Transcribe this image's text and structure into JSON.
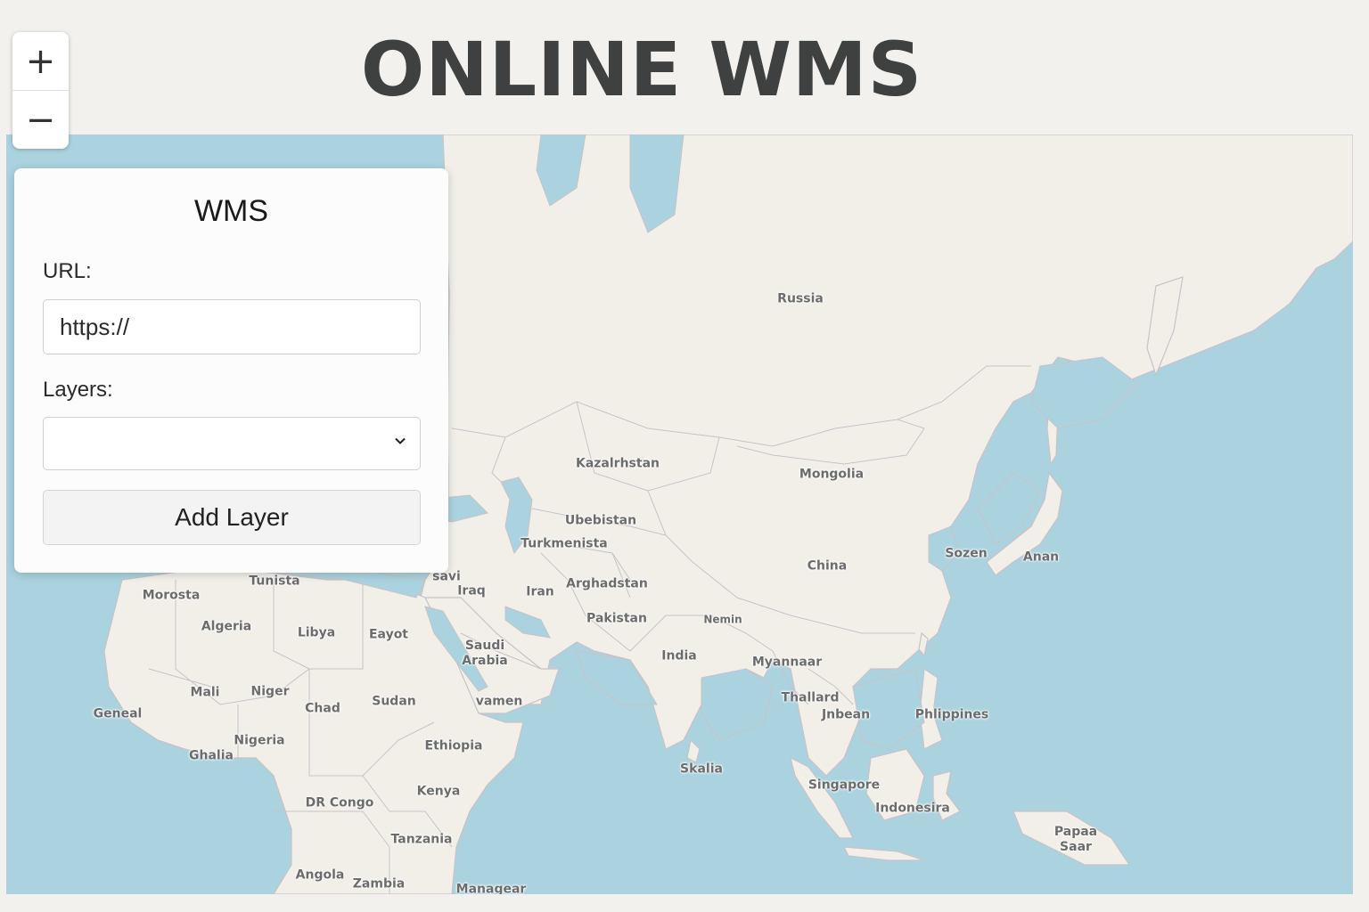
{
  "page": {
    "title": "ONLINE WMS"
  },
  "zoom": {
    "in_label": "+",
    "out_label": "−"
  },
  "panel": {
    "title": "WMS",
    "url_label": "URL:",
    "url_value": "https://",
    "layers_label": "Layers:",
    "layers_selected": "",
    "add_button": "Add Layer"
  },
  "map": {
    "colors": {
      "water": "#aad3df",
      "land": "#f2efe9",
      "border": "#c9c2c6"
    },
    "labels": [
      "Russia",
      "Kazalrhstan",
      "Mongolia",
      "Ubebistan",
      "Turkmenista",
      "China",
      "Sozen",
      "Anan",
      "savi",
      "Iraq",
      "Iran",
      "Arghadstan",
      "Tunista",
      "Morosta",
      "Algeria",
      "Libya",
      "Eayot",
      "Pakistan",
      "Nemin",
      "Saudi Arabia",
      "India",
      "Myannaar",
      "Mali",
      "Niger",
      "Chad",
      "Sudan",
      "vamen",
      "Thallard",
      "Jnbean",
      "Phlippines",
      "Geneal",
      "Nigeria",
      "Ethiopia",
      "Ghalia",
      "Skalia",
      "Singapore",
      "Kenya",
      "DR Congo",
      "Indonesira",
      "Tanzania",
      "Papaa Saar",
      "Angola",
      "Zambia",
      "Managear"
    ]
  }
}
